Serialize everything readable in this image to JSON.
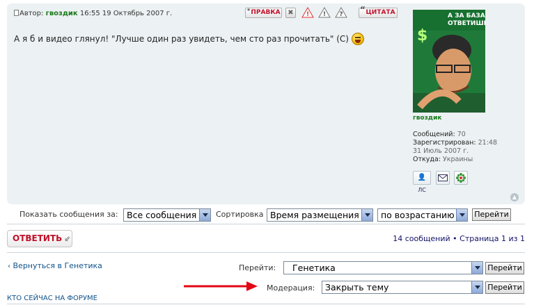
{
  "post": {
    "author_prefix": "Автор:",
    "author": "гвоздик",
    "datetime": "16:55 19 Октябрь 2007 г.",
    "body_text": "А я б и видео глянул! \"Лучше один раз увидеть, чем сто раз прочитать\" (С)",
    "buttons": {
      "edit_label": "ПРАВКА",
      "delete_icon": "x-icon",
      "report_icon": "report-icon",
      "warn_icon": "warning-icon",
      "info_icon": "question-icon",
      "quote_label": "ЦИТАТА"
    },
    "smiley_icon": "laughing-smiley-icon"
  },
  "profile": {
    "username": "гвоздик",
    "avatar_text_line1": "А ЗА БАЗАР",
    "avatar_text_line2": "ОТВЕТИШЬ?",
    "avatar_symbol": "$",
    "posts_label": "Сообщений:",
    "posts_value": "70",
    "registered_label": "Зарегистрирован:",
    "registered_time": "21:48",
    "registered_date": "31 Июль 2007 г.",
    "from_label": "Откуда:",
    "from_value": "Украины",
    "icons": [
      "pm-icon",
      "email-icon",
      "icq-icon"
    ],
    "pm_label": "ЛС",
    "top_icon": "back-to-top-icon"
  },
  "display_options": {
    "show_label": "Показать сообщения за:",
    "show_value": "Все сообщения",
    "sort_label": "Сортировка",
    "sort_value": "Время размещения",
    "order_value": "по возрастанию",
    "go_label": "Перейти"
  },
  "actions": {
    "reply_label": "ОТВЕТИТЬ",
    "pagination": "14 сообщений • Страница 1 из 1"
  },
  "footer": {
    "back_link": "Вернуться в Генетика",
    "jump_label": "Перейти:",
    "jump_value": "Генетика",
    "jump_go": "Перейти",
    "mod_label": "Модерация:",
    "mod_value": "Закрыть тему",
    "mod_go": "Перейти",
    "who_online": "КТО СЕЙЧАС НА ФОРУМЕ"
  },
  "colors": {
    "post_bg": "#ecf1f3",
    "author_green": "#1a7a1a",
    "button_red": "#c0102a",
    "link_blue": "#105289",
    "arrow_red": "#e30613"
  }
}
